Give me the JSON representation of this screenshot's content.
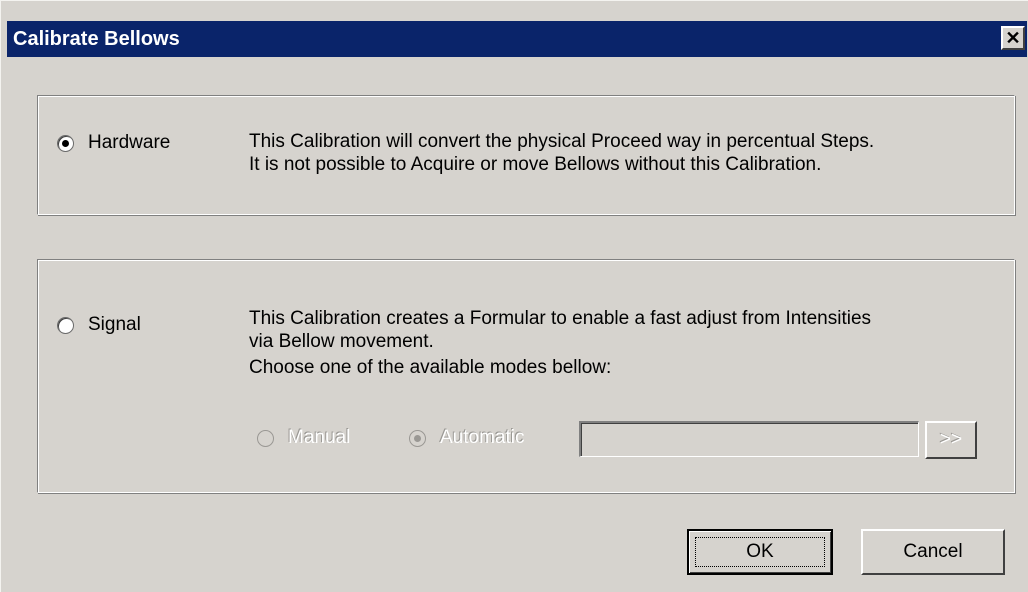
{
  "window": {
    "title": "Calibrate Bellows",
    "close_glyph": "✕"
  },
  "hardware_group": {
    "radio_label": "Hardware",
    "radio_checked": true,
    "description_line1": "This Calibration will convert the physical Proceed way in percentual Steps.",
    "description_line2": "It is not possible to Acquire or move Bellows without this Calibration."
  },
  "signal_group": {
    "radio_label": "Signal",
    "radio_checked": false,
    "description_line1": "This Calibration creates a Formular to enable a fast adjust from Intensities",
    "description_line2": "via Bellow movement.",
    "description_line3": "Choose one of the available modes bellow:",
    "modes": {
      "manual_label": "Manual",
      "manual_checked": false,
      "automatic_label": "Automatic",
      "automatic_checked": true,
      "enabled": false
    },
    "path_field_value": "",
    "browse_button_label": ">>"
  },
  "buttons": {
    "ok_label": "OK",
    "cancel_label": "Cancel"
  },
  "colors": {
    "titlebar": "#0a246a",
    "dialog_face": "#d6d3ce"
  }
}
